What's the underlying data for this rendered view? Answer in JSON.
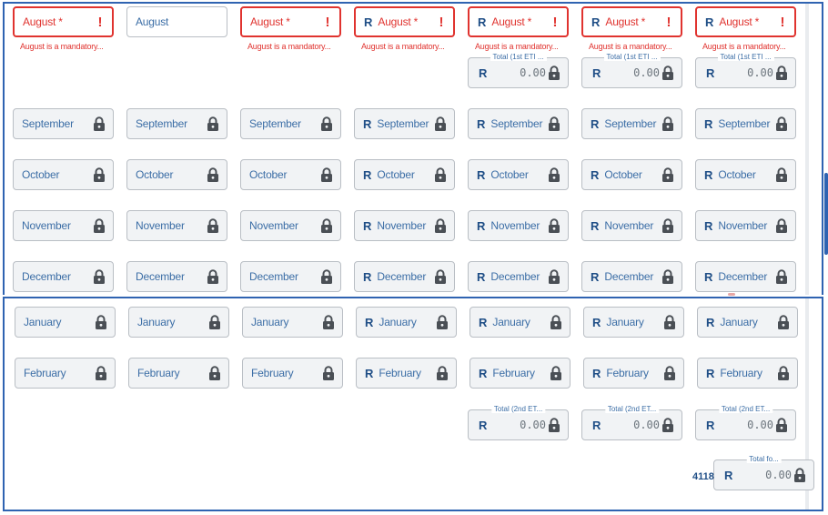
{
  "currency": "R",
  "months": {
    "august": "August",
    "august_required": "August *",
    "september": "September",
    "october": "October",
    "november": "November",
    "december": "December",
    "january": "January",
    "february": "February"
  },
  "error_message": "August is a mandatory...",
  "totals": {
    "first_eti_label": "Total (1st ETI ...",
    "second_eti_label": "Total (2nd ET...",
    "grand_label": "Total fo...",
    "amount": "0.00"
  },
  "side_number": "4118",
  "colors": {
    "border_accent": "#2f63b1",
    "error": "#e0332f",
    "label_text": "#3c6ea6",
    "currency_text": "#1f4e86",
    "field_background": "#f1f3f5"
  },
  "icons": {
    "lock": "lock-icon",
    "error": "exclamation-icon"
  }
}
